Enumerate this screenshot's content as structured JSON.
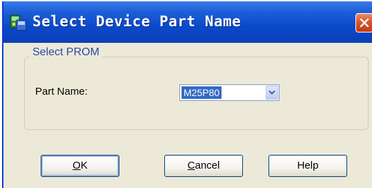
{
  "window": {
    "title": "Select Device Part Name",
    "title_icon": "device-app-icon",
    "close_icon": "close-icon"
  },
  "group": {
    "label": "Select PROM"
  },
  "part_name": {
    "label": "Part Name:",
    "selected_value": "M25P80",
    "arrow_icon": "chevron-down-icon"
  },
  "buttons": {
    "ok": {
      "mnemonic": "O",
      "rest": "K"
    },
    "cancel": {
      "mnemonic": "C",
      "rest": "ancel"
    },
    "help": {
      "label": "Help"
    }
  },
  "colors": {
    "titlebar": "#0b49c9",
    "selection": "#316ac5",
    "close_button": "#d5522c",
    "group_label": "#2a49a6",
    "dialog_background": "#ece9d8"
  }
}
